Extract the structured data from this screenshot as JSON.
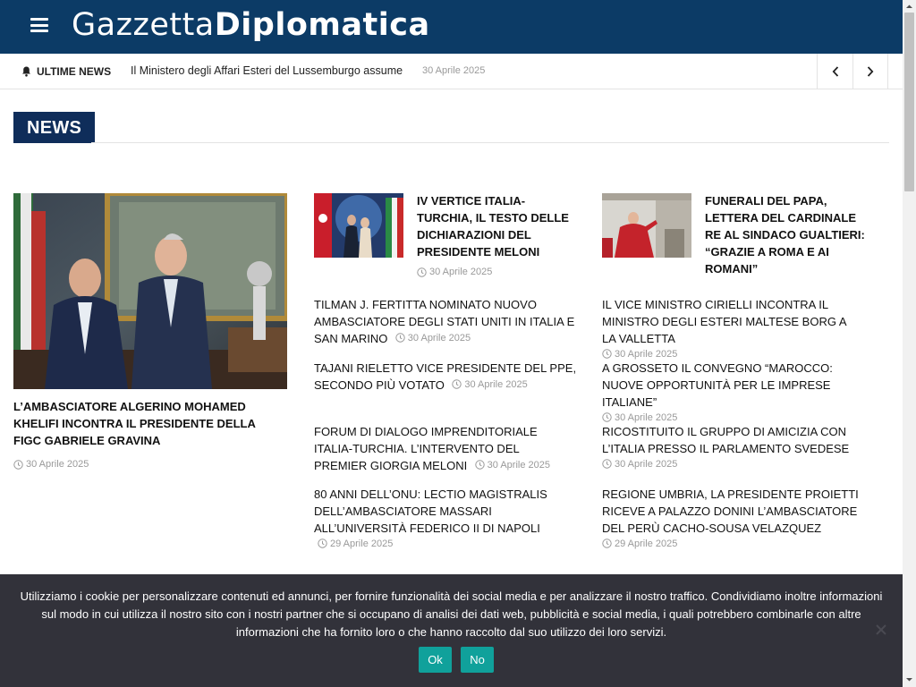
{
  "header": {
    "logo_part1": "Gazzetta",
    "logo_part2": "Diplomatica"
  },
  "ticker": {
    "label": "ULTIME NEWS",
    "headline": "Il Ministero degli Affari Esteri del Lussemburgo assume",
    "date": "30 Aprile 2025"
  },
  "section": {
    "title": "NEWS"
  },
  "featured": {
    "title": "L’ambasciatore algerino Mohamed Khelifi incontra il presidente della FIGC Gabriele Gravina",
    "date": "30 Aprile 2025"
  },
  "column2": {
    "top": {
      "title": "IV Vertice Italia-Turchia, il testo delle dichiarazioni del Presidente Meloni",
      "date": "30 Aprile 2025"
    },
    "items": [
      {
        "title": "Tilman J. Fertitta nominato nuovo Ambasciatore degli Stati Uniti in Italia e San Marino",
        "date": "30 Aprile 2025"
      },
      {
        "title": "Tajani rieletto vice presidente del PPE, secondo più votato",
        "date": "30 Aprile 2025"
      },
      {
        "title": "Forum di Dialogo Imprenditoriale Italia-Turchia. L’intervento del Premier Giorgia Meloni",
        "date": "30 Aprile 2025"
      },
      {
        "title": "80 anni dell’Onu: lectio magistralis dell’Ambasciatore Massari all’Università Federico II di Napoli",
        "date": "29 Aprile 2025"
      }
    ]
  },
  "column3": {
    "top": {
      "title": "Funerali del Papa, lettera del Cardinale Re al sindaco Gualtieri: “Grazie a Roma e ai romani”",
      "date": ""
    },
    "items": [
      {
        "title": "Il Vice Ministro Cirielli incontra il Ministro degli Esteri maltese Borg a La Valletta",
        "date": "30 Aprile 2025"
      },
      {
        "title": "A Grosseto il convegno “Marocco: nuove opportunità per le imprese italiane”",
        "date": "30 Aprile 2025"
      },
      {
        "title": "Ricostituito il Gruppo di Amicizia con l’Italia presso il Parlamento svedese",
        "date": "30 Aprile 2025"
      },
      {
        "title": "Regione Umbria, la Presidente Proietti riceve a Palazzo Donini l’Ambasciatore del Perù Cacho-Sousa Velazquez",
        "date": "29 Aprile 2025"
      }
    ]
  },
  "cookie": {
    "text": "Utilizziamo i cookie per personalizzare contenuti ed annunci, per fornire funzionalità dei social media e per analizzare il nostro traffico. Condividiamo inoltre informazioni sul modo in cui utilizza il nostro sito con i nostri partner che si occupano di analisi dei dati web, pubblicità e social media, i quali potrebbero combinarle con altre informazioni che ha fornito loro o che hanno raccolto dal suo utilizzo dei loro servizi.",
    "ok_label": "Ok",
    "no_label": "No"
  },
  "colors": {
    "header_bg": "#0c3b66",
    "section_bg": "#0f2d5a",
    "cookie_bg": "#32323a",
    "button_teal": "#10a19b"
  },
  "icons": [
    "menu-icon",
    "bell-icon",
    "chevron-left-icon",
    "chevron-right-icon",
    "clock-icon",
    "close-icon"
  ]
}
